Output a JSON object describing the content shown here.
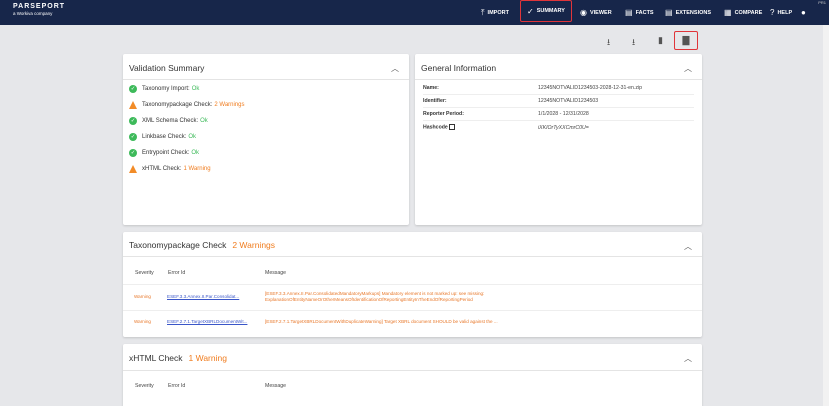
{
  "topbar": {
    "logo_line1": "PARSEPORT",
    "logo_line2": "a Workiva company",
    "version": "PR1",
    "nav": [
      {
        "icon": "⤒",
        "label": "IMPORT"
      },
      {
        "icon": "✓",
        "label": "SUMMARY"
      },
      {
        "icon": "◉",
        "label": "VIEWER"
      },
      {
        "icon": "▤",
        "label": "FACTS"
      },
      {
        "icon": "▤",
        "label": "EXTENSIONS"
      },
      {
        "icon": "▦",
        "label": "COMPARE"
      },
      {
        "icon": "?",
        "label": "HELP"
      },
      {
        "icon": "●",
        "label": ""
      }
    ]
  },
  "toolbar": {
    "icons": [
      "⭳",
      "⭳",
      "▮",
      "▇"
    ]
  },
  "validation": {
    "title": "Validation Summary",
    "rows": [
      {
        "label": "Taxonomy Import:",
        "status": "Ok",
        "type": "ok"
      },
      {
        "label": "Taxonomypackage Check:",
        "status": "2 Warnings",
        "type": "warn"
      },
      {
        "label": "XML Schema Check:",
        "status": "Ok",
        "type": "ok"
      },
      {
        "label": "Linkbase Check:",
        "status": "Ok",
        "type": "ok"
      },
      {
        "label": "Entrypoint Check:",
        "status": "Ok",
        "type": "ok"
      },
      {
        "label": "xHTML Check:",
        "status": "1 Warning",
        "type": "warn"
      }
    ]
  },
  "general": {
    "title": "General Information",
    "rows": [
      {
        "k": "Name:",
        "v": "12345NOTVALID1234503-2028-12-31-en.zip"
      },
      {
        "k": "Identifier:",
        "v": "12345NOTVALID1234503"
      },
      {
        "k": "Reporter Period:",
        "v": "1/1/2028 - 12/31/2028"
      },
      {
        "k": "Hashcode",
        "v": "iXKIOrTyXXCmrC0U="
      }
    ]
  },
  "taxcheck": {
    "title": "Taxonomypackage Check",
    "badge": "2 Warnings",
    "headers": {
      "severity": "Severity",
      "error": "Error Id",
      "message": "Message"
    },
    "rows": [
      {
        "severity": "Warning",
        "error": "ESEF.3.3.Annex.II.Par.Consolidat...",
        "message1": "[ESEF.3.3.Annex.II.Par.ConsolidatedMandatoryMarkups] Mandatory element is not marked up: see missing:",
        "message2": "ExplanationOfEntityNameOrOtherMeansOfIdentificationOfReportingEntityInTheEndOfReportingPeriod"
      },
      {
        "severity": "Warning",
        "error": "ESEF.2.7.1.TargetXBRLDocumentWit...",
        "message1": "[ESEF.2.7.1.TargetXBRLDocumentWithDuplicateWarning] Target XBRL document SHOULD be valid against the ...",
        "message2": ""
      }
    ]
  },
  "xhtml": {
    "title": "xHTML Check",
    "badge": "1 Warning",
    "headers": {
      "severity": "Severity",
      "error": "Error Id",
      "message": "Message"
    }
  }
}
